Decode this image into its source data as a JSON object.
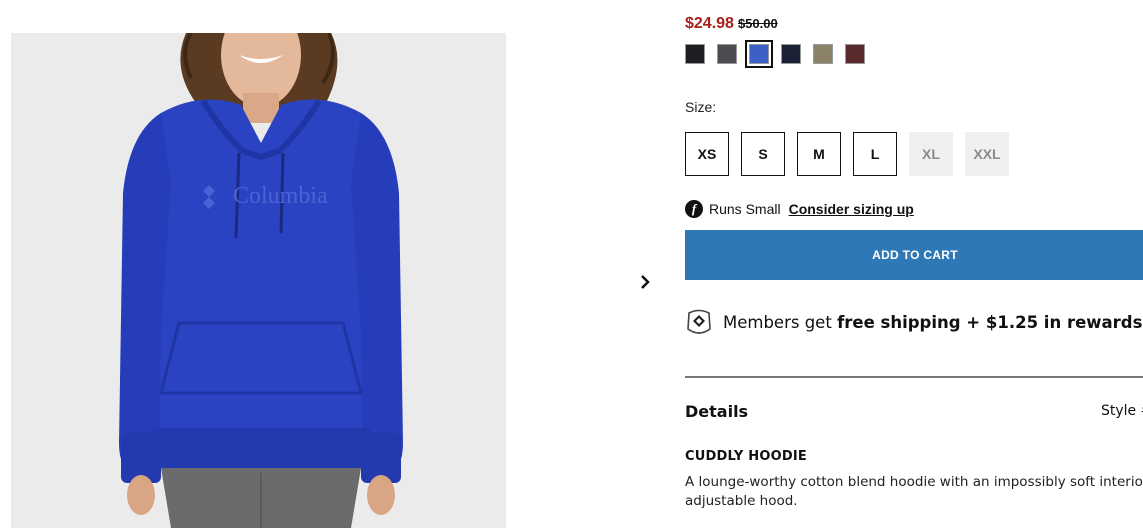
{
  "price": {
    "sale": "$24.98",
    "original": "$50.00"
  },
  "swatches": [
    {
      "name": "Black",
      "color": "#1d1f22"
    },
    {
      "name": "Dark Grey",
      "color": "#4b4c4f"
    },
    {
      "name": "Azul",
      "color": "#3d5fc8",
      "selected": true
    },
    {
      "name": "Dark Navy",
      "color": "#1c2236"
    },
    {
      "name": "Tan",
      "color": "#8c826a"
    },
    {
      "name": "Red Jasper",
      "color": "#5b2a2c"
    }
  ],
  "size": {
    "label": "Size:",
    "options": [
      {
        "label": "XS",
        "available": true
      },
      {
        "label": "S",
        "available": true
      },
      {
        "label": "M",
        "available": true
      },
      {
        "label": "L",
        "available": true
      },
      {
        "label": "XL",
        "available": false
      },
      {
        "label": "XXL",
        "available": false
      }
    ]
  },
  "fit": {
    "icon": "fit-predictor-icon",
    "text": "Runs Small",
    "link": "Consider sizing up"
  },
  "cart": {
    "label": "ADD TO CART",
    "color": "#2f78b6"
  },
  "members": {
    "prefix": "Members get",
    "bold": "free shipping + $1.25 in rewards",
    "icon": "rewards-diamond-icon"
  },
  "details": {
    "title": "Details",
    "style_label": "Style #",
    "product_name": "CUDDLY HOODIE",
    "description_line1": "A lounge-worthy cotton blend hoodie with an impossibly soft interior a",
    "description_line2": "adjustable hood."
  },
  "image": {
    "logo_text": "Columbia",
    "garment_color": "#2a43c2"
  },
  "nav": {
    "next_icon": "chevron-right-icon"
  }
}
